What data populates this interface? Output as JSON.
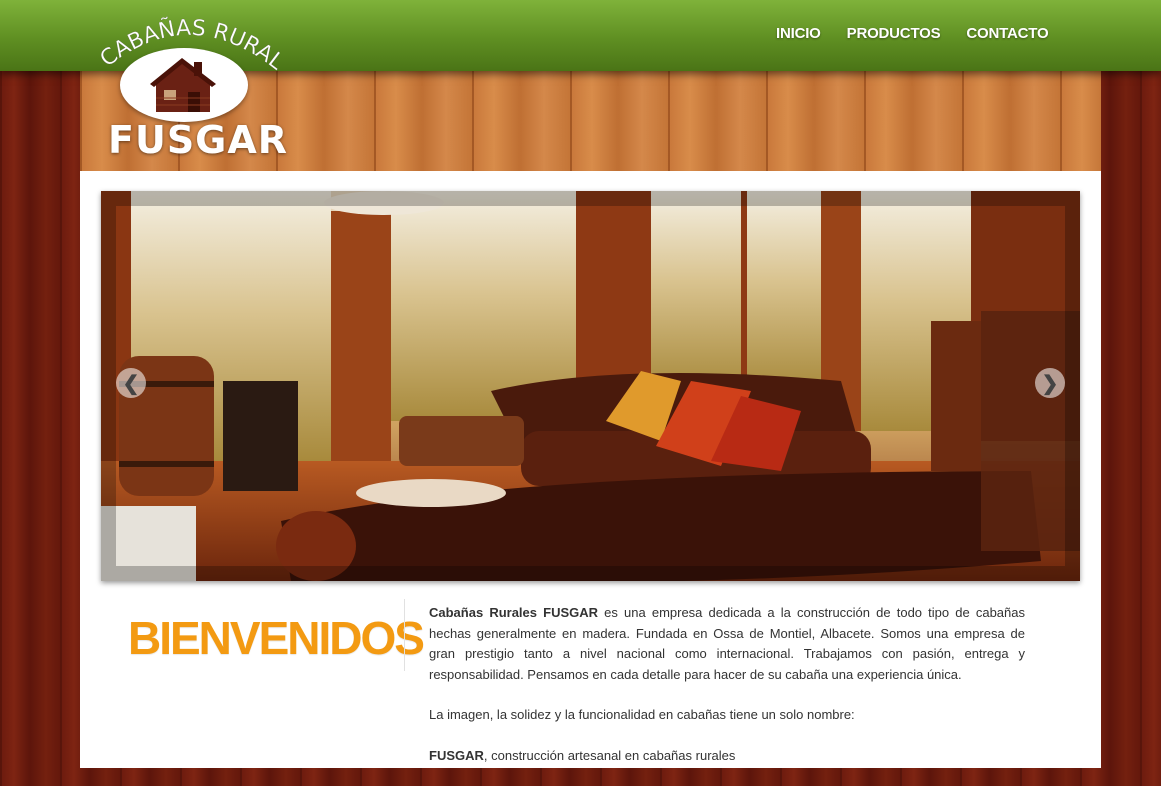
{
  "nav": {
    "items": [
      "INICIO",
      "PRODUCTOS",
      "CONTACTO"
    ]
  },
  "logo": {
    "arc_text": "CABAÑAS RURALES",
    "brand": "FUSGAR"
  },
  "slider": {
    "prev_symbol": "❮",
    "next_symbol": "❯"
  },
  "welcome": {
    "heading": "BIENVENIDOS",
    "p1_bold": "Cabañas Rurales FUSGAR",
    "p1_text": " es una empresa dedicada a la construcción de todo tipo de cabañas hechas generalmente en madera. Fundada en Ossa de Montiel, Albacete. Somos una empresa de gran prestigio tanto a nivel nacional como internacional. Trabajamos con pasión, entrega y responsabilidad. Pensamos en cada detalle para hacer de su cabaña una experiencia única.",
    "p2_text": "La imagen, la solidez y la funcionalidad en cabañas tiene un solo nombre:",
    "p3_bold": "FUSGAR",
    "p3_text": ", construcción artesanal en cabañas rurales"
  },
  "colors": {
    "nav_green": "#5f8f22",
    "heading_orange": "#f39a12",
    "wood_dark": "#6b1a0e",
    "wood_light": "#c8773a"
  }
}
